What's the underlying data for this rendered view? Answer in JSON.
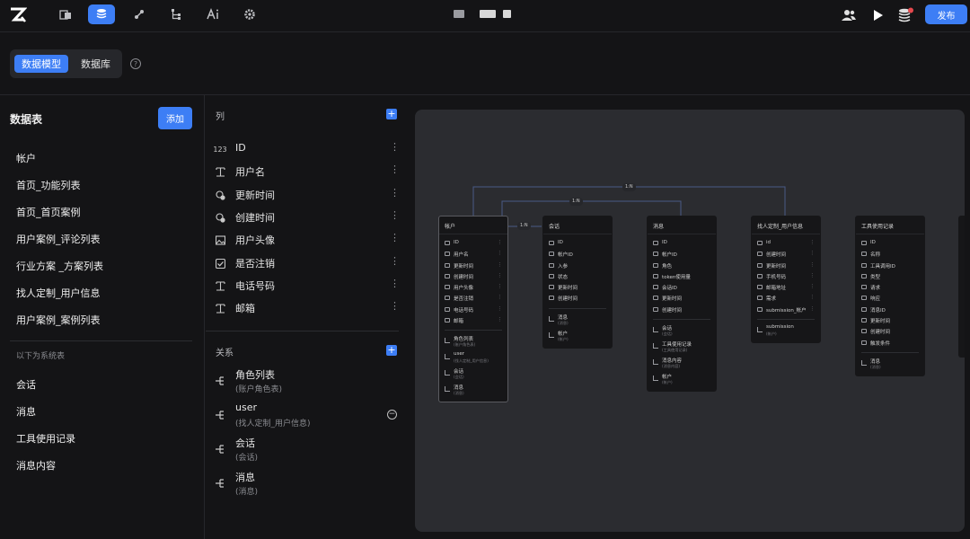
{
  "topbar": {
    "nav_icons": [
      "pages-icon",
      "database-icon",
      "workflow-icon",
      "tree-icon",
      "ai-icon",
      "settings-icon"
    ],
    "active_nav": "database-icon",
    "right_icons": [
      "users-icon",
      "play-icon",
      "db-status-icon"
    ],
    "publish_label": "发布"
  },
  "tabs": {
    "items": [
      "数据模型",
      "数据库"
    ],
    "active": "数据模型"
  },
  "tables_panel": {
    "title": "数据表",
    "add_label": "添加",
    "user_tables": [
      "帐户",
      "首页_功能列表",
      "首页_首页案例",
      "用户案例_评论列表",
      "行业方案 _方案列表",
      "找人定制_用户信息",
      "用户案例_案例列表"
    ],
    "system_label": "以下为系统表",
    "system_tables": [
      "会话",
      "消息",
      "工具使用记录",
      "消息内容"
    ]
  },
  "columns_panel": {
    "title": "列",
    "columns": [
      {
        "name": "ID",
        "icon": "number-icon"
      },
      {
        "name": "用户名",
        "icon": "text-icon"
      },
      {
        "name": "更新时间",
        "icon": "clock-icon"
      },
      {
        "name": "创建时间",
        "icon": "clock-icon"
      },
      {
        "name": "用户头像",
        "icon": "image-icon"
      },
      {
        "name": "是否注销",
        "icon": "checkbox-icon"
      },
      {
        "name": "电话号码",
        "icon": "text-icon"
      },
      {
        "name": "邮箱",
        "icon": "text-icon"
      }
    ],
    "relations_title": "关系",
    "relations": [
      {
        "name": "角色列表",
        "target": "(账户角色表)"
      },
      {
        "name": "user",
        "target": "(找人定制_用户信息)"
      },
      {
        "name": "会话",
        "target": "(会话)"
      },
      {
        "name": "消息",
        "target": "(消息)"
      }
    ]
  },
  "diagram": {
    "edge_labels": [
      "1:N",
      "1:N",
      "1:N"
    ],
    "cards": [
      {
        "title": "帐户",
        "fields": [
          "ID",
          "用户名",
          "更新时间",
          "创建时间",
          "用户头像",
          "是否注销",
          "电话号码",
          "邮箱"
        ],
        "relations": [
          {
            "name": "角色列表",
            "sub": "(账户角色表)"
          },
          {
            "name": "user",
            "sub": "(找人定制_用户信息)"
          },
          {
            "name": "会话",
            "sub": "(会话)"
          },
          {
            "name": "消息",
            "sub": "(消息)"
          }
        ]
      },
      {
        "title": "会话",
        "fields": [
          "ID",
          "帐户ID",
          "入参",
          "状态",
          "更新时间",
          "创建时间"
        ],
        "relations": [
          {
            "name": "消息",
            "sub": "(消息)"
          },
          {
            "name": "帐户",
            "sub": "(帐户)"
          }
        ]
      },
      {
        "title": "消息",
        "fields": [
          "ID",
          "帐户ID",
          "角色",
          "token使用量",
          "会话ID",
          "更新时间",
          "创建时间"
        ],
        "relations": [
          {
            "name": "会话",
            "sub": "(会话)"
          },
          {
            "name": "工具使用记录",
            "sub": "(工具使用记录)"
          },
          {
            "name": "消息内容",
            "sub": "(消息内容)"
          },
          {
            "name": "帐户",
            "sub": "(帐户)"
          }
        ]
      },
      {
        "title": "找人定制_用户信息",
        "fields": [
          "id",
          "创建时间",
          "更新时间",
          "手机号码",
          "邮箱地址",
          "需求",
          "submission_帐户"
        ],
        "relations": [
          {
            "name": "submission",
            "sub": "(帐户)"
          }
        ]
      },
      {
        "title": "工具使用记录",
        "fields": [
          "ID",
          "名称",
          "工具调用ID",
          "类型",
          "请求",
          "响应",
          "消息ID",
          "更新时间",
          "创建时间",
          "触发条件"
        ],
        "relations": [
          {
            "name": "消息",
            "sub": "(消息)"
          }
        ]
      }
    ]
  }
}
